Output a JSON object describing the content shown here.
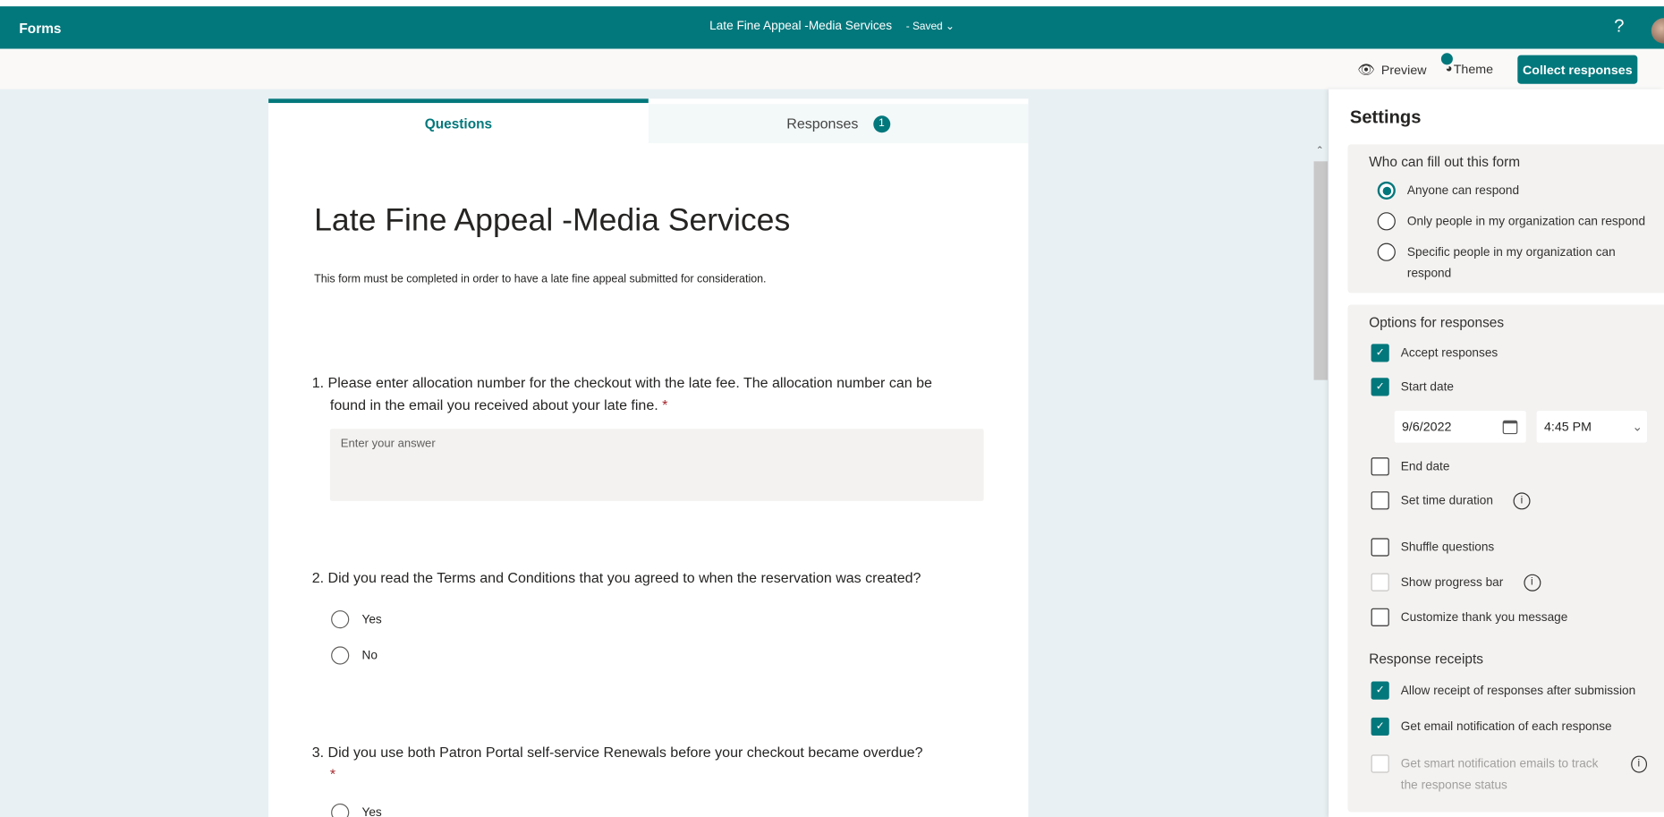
{
  "app": {
    "name": "Forms",
    "document_title": "Late Fine Appeal -Media Services",
    "save_status": "Saved",
    "help": "?"
  },
  "toolbar": {
    "preview": "Preview",
    "theme": "Theme",
    "collect": "Collect responses"
  },
  "tabs": {
    "questions": "Questions",
    "responses": "Responses",
    "responses_count": "1"
  },
  "form": {
    "title": "Late Fine Appeal -Media Services",
    "description": "This form must be completed in order to have a late fine appeal submitted for consideration.",
    "questions": [
      {
        "text": "1. Please enter allocation number for the checkout with the late fee. The allocation number can be found in the email you received about your late fine.",
        "required": "*",
        "placeholder": "Enter your answer"
      },
      {
        "text": "2. Did you read the Terms and Conditions that you agreed to when the reservation was created?",
        "options": [
          "Yes",
          "No"
        ]
      },
      {
        "text": "3. Did you use both Patron Portal self-service Renewals before your checkout became overdue?",
        "required": "*",
        "options": [
          "Yes"
        ]
      }
    ]
  },
  "settings": {
    "title": "Settings",
    "who": {
      "heading": "Who can fill out this form",
      "options": [
        "Anyone can respond",
        "Only people in my organization can respond",
        "Specific people in my organization can respond"
      ],
      "selected": "Anyone can respond"
    },
    "options": {
      "heading": "Options for responses",
      "accept": {
        "label": "Accept responses",
        "checked": true
      },
      "start": {
        "label": "Start date",
        "checked": true,
        "date": "9/6/2022",
        "time": "4:45 PM"
      },
      "end": {
        "label": "End date",
        "checked": false
      },
      "duration": {
        "label": "Set time duration",
        "checked": false
      },
      "shuffle": {
        "label": "Shuffle questions",
        "checked": false
      },
      "progress": {
        "label": "Show progress bar",
        "checked": false
      },
      "thankyou": {
        "label": "Customize thank you message",
        "checked": false
      }
    },
    "receipts": {
      "heading": "Response receipts",
      "allow": {
        "label": "Allow receipt of responses after submission",
        "checked": true
      },
      "email": {
        "label": "Get email notification of each response",
        "checked": true
      },
      "smart": {
        "label": "Get smart notification emails to track the response status",
        "checked": false,
        "disabled": true
      }
    }
  },
  "colors": {
    "brand": "#03787c",
    "background": "#e8f0f3",
    "required": "#a4262c"
  }
}
